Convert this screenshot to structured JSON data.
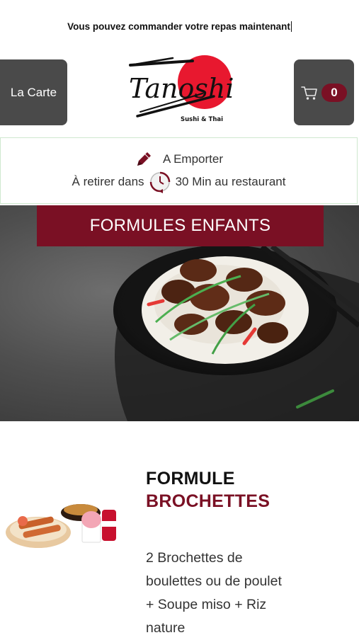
{
  "banner": {
    "text": "Vous pouvez commander votre repas maintenant"
  },
  "header": {
    "menu_label": "La Carte",
    "cart_count": "0",
    "logo_text": "Tanoshi",
    "logo_tagline": "Sushi & Thai"
  },
  "order": {
    "mode": "A Emporter",
    "pickup_prefix": "À retirer dans",
    "pickup_time": "30 Min au restaurant"
  },
  "hero": {
    "title": "FORMULES ENFANTS"
  },
  "product": {
    "title_line1": "FORMULE",
    "title_line2": "BROCHETTES",
    "description": "2 Brochettes de boulettes ou de poulet  + Soupe miso  + Riz nature"
  },
  "colors": {
    "accent": "#7a1024",
    "logo_red": "#e8182f",
    "button_gray": "#4a4a4a"
  },
  "icons": [
    "cart-icon",
    "pencil-icon",
    "clock-icon"
  ]
}
